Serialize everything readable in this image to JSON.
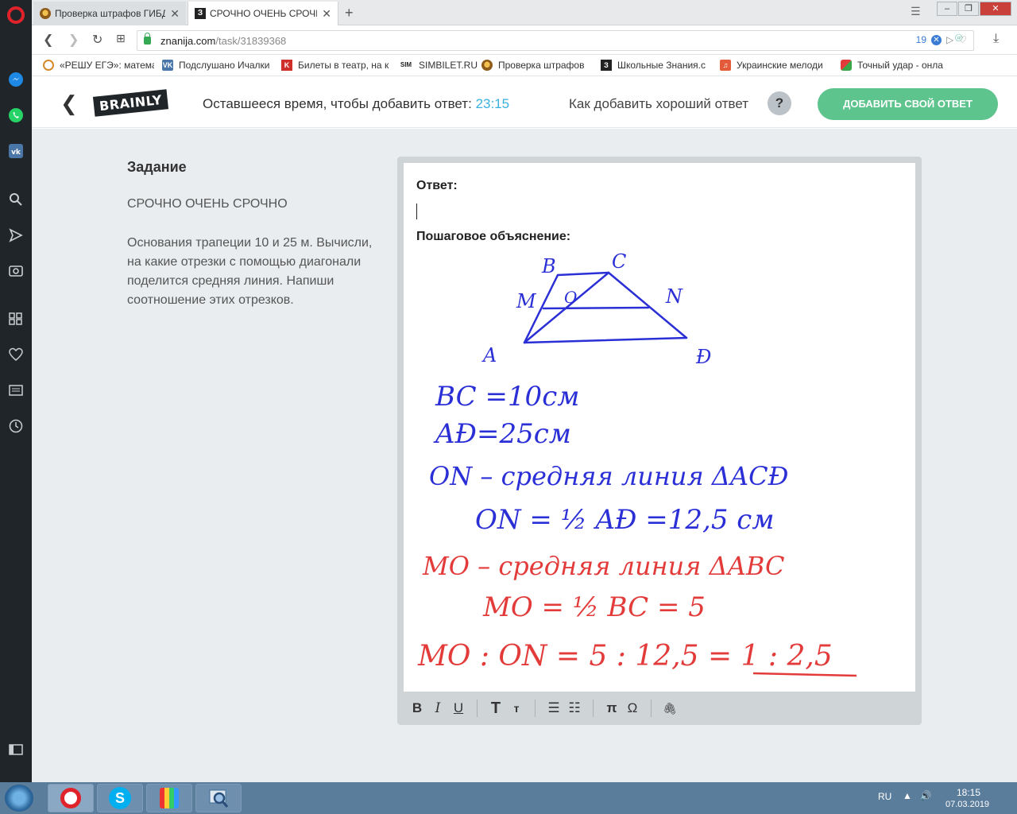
{
  "browser": {
    "tabs": [
      {
        "label": "Проверка штрафов ГИБД"
      },
      {
        "label": "СРОЧНО ОЧЕНЬ СРОЧНО"
      }
    ],
    "tab_favicon_z": "З",
    "url_domain": "znanija.com",
    "url_path": "/task/31839368",
    "badge_count": "19",
    "bookmarks": [
      {
        "label": "«РЕШУ ЕГЭ»: матема"
      },
      {
        "label": "Подслушано Ичалки"
      },
      {
        "label": "Билеты в театр, на к"
      },
      {
        "label": "SIMBILET.RU"
      },
      {
        "label": "Проверка штрафов"
      },
      {
        "label": "Школьные Знания.с"
      },
      {
        "label": "Украинские мелоди"
      },
      {
        "label": "Точный удар - онла"
      }
    ],
    "bookmark_icon_text": {
      "vk": "VK",
      "sim": "SIM",
      "z": "З"
    }
  },
  "header": {
    "timer_label": "Оставшееся время, чтобы добавить ответ:",
    "timer_value": "23:15",
    "howto": "Как добавить хороший ответ",
    "help": "?",
    "add_answer": "ДОБАВИТЬ СВОЙ ОТВЕТ",
    "logo": "BRAINLY"
  },
  "task": {
    "heading": "Задание",
    "title": "СРОЧНО ОЧЕНЬ СРОЧНО",
    "body": "Основания трапеции 10 и 25 м. Вычисли, на какие отрезки с помощью диагонали поделится средняя линия. Напиши соотношение этих отрезков."
  },
  "editor": {
    "answer_label": "Ответ:",
    "explain_label": "Пошаговое объяснение:",
    "sketch": {
      "vertices": {
        "B": "B",
        "C": "C",
        "M": "M",
        "O": "O",
        "N": "N",
        "A": "A",
        "D": "Ð"
      },
      "lines": [
        "BC =10см",
        "AÐ=25см",
        "ON – средняя линия ΔACÐ",
        "ON = ½ AÐ =12,5 см",
        "MO – средняя линия ΔABC",
        "MO = ½ BC = 5",
        "MO : ON = 5 : 12,5 = 1 : 2,5"
      ],
      "colors": {
        "blue": "#2b2fd6",
        "red": "#e33a3a"
      }
    },
    "toolbar": {
      "bold": "B",
      "italic": "I",
      "underline": "U",
      "heading_big": "T",
      "heading_small": "т",
      "ordered_list": "☰",
      "bullet_list": "☷",
      "pi": "π",
      "omega": "Ω",
      "attach": "🖇"
    }
  },
  "taskbar": {
    "lang": "RU",
    "time": "18:15",
    "date": "07.03.2019"
  },
  "colors": {
    "brainly_green": "#5ec48d",
    "timer_blue": "#3ab0de",
    "opera_red": "#e0232b"
  }
}
